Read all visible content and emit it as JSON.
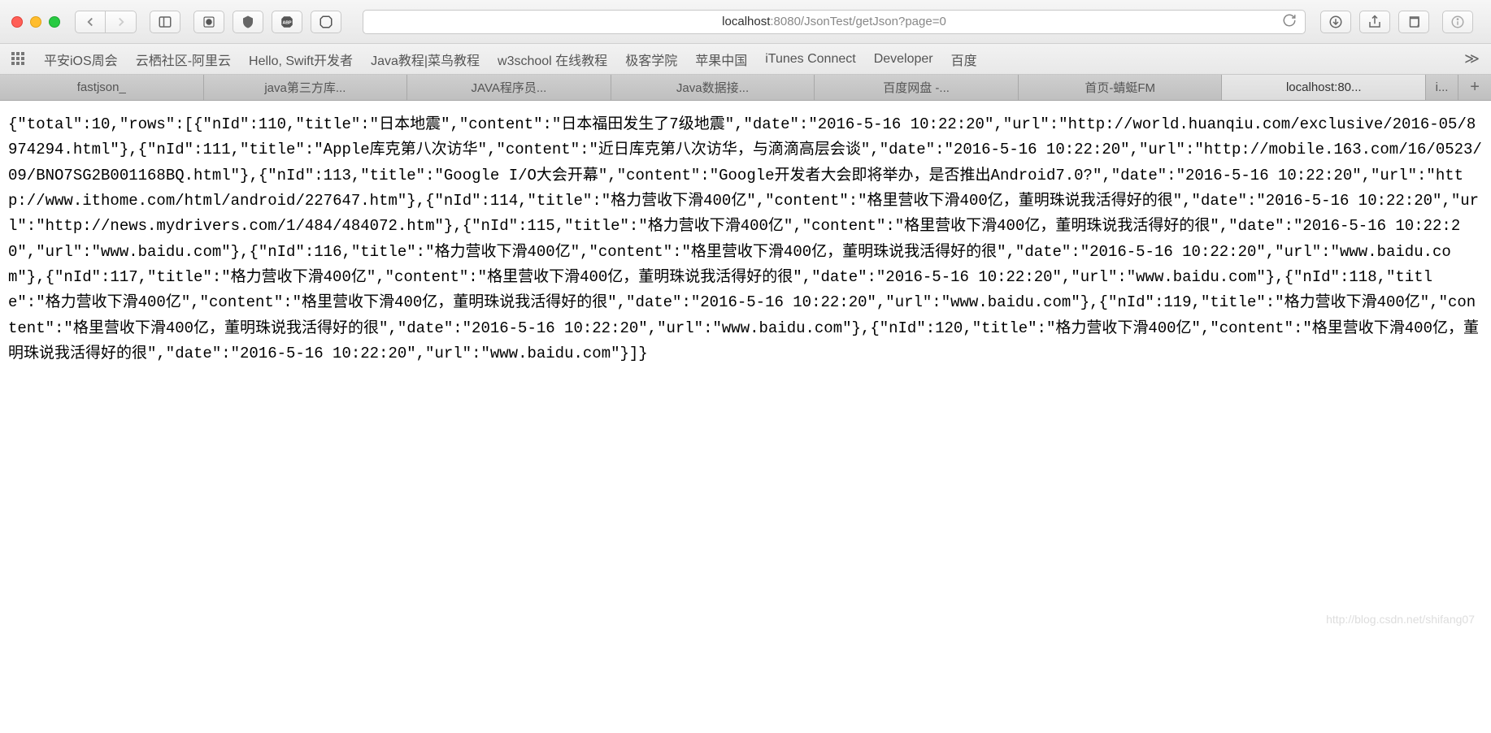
{
  "address": {
    "host": "localhost",
    "port": ":8080",
    "path": "/JsonTest/getJson?page=0"
  },
  "bookmarks": [
    "平安iOS周会",
    "云栖社区-阿里云",
    "Hello, Swift开发者",
    "Java教程|菜鸟教程",
    "w3school 在线教程",
    "极客学院",
    "苹果中国",
    "iTunes Connect",
    "Developer",
    "百度"
  ],
  "tabs": [
    {
      "label": "fastjson_",
      "active": false
    },
    {
      "label": "java第三方库...",
      "active": false
    },
    {
      "label": "JAVA程序员...",
      "active": false
    },
    {
      "label": "Java数据接...",
      "active": false
    },
    {
      "label": "百度网盘 -...",
      "active": false
    },
    {
      "label": "首页-蜻蜓FM",
      "active": false
    },
    {
      "label": "localhost:80...",
      "active": true
    },
    {
      "label": "i...",
      "active": false,
      "small": true
    }
  ],
  "json_body": "{\"total\":10,\"rows\":[{\"nId\":110,\"title\":\"日本地震\",\"content\":\"日本福田发生了7级地震\",\"date\":\"2016-5-16 10:22:20\",\"url\":\"http://world.huanqiu.com/exclusive/2016-05/8974294.html\"},{\"nId\":111,\"title\":\"Apple库克第八次访华\",\"content\":\"近日库克第八次访华，与滴滴高层会谈\",\"date\":\"2016-5-16 10:22:20\",\"url\":\"http://mobile.163.com/16/0523/09/BNO7SG2B001168BQ.html\"},{\"nId\":113,\"title\":\"Google I/O大会开幕\",\"content\":\"Google开发者大会即将举办，是否推出Android7.0?\",\"date\":\"2016-5-16 10:22:20\",\"url\":\"http://www.ithome.com/html/android/227647.htm\"},{\"nId\":114,\"title\":\"格力营收下滑400亿\",\"content\":\"格里营收下滑400亿，董明珠说我活得好的很\",\"date\":\"2016-5-16 10:22:20\",\"url\":\"http://news.mydrivers.com/1/484/484072.htm\"},{\"nId\":115,\"title\":\"格力营收下滑400亿\",\"content\":\"格里营收下滑400亿，董明珠说我活得好的很\",\"date\":\"2016-5-16 10:22:20\",\"url\":\"www.baidu.com\"},{\"nId\":116,\"title\":\"格力营收下滑400亿\",\"content\":\"格里营收下滑400亿，董明珠说我活得好的很\",\"date\":\"2016-5-16 10:22:20\",\"url\":\"www.baidu.com\"},{\"nId\":117,\"title\":\"格力营收下滑400亿\",\"content\":\"格里营收下滑400亿，董明珠说我活得好的很\",\"date\":\"2016-5-16 10:22:20\",\"url\":\"www.baidu.com\"},{\"nId\":118,\"title\":\"格力营收下滑400亿\",\"content\":\"格里营收下滑400亿，董明珠说我活得好的很\",\"date\":\"2016-5-16 10:22:20\",\"url\":\"www.baidu.com\"},{\"nId\":119,\"title\":\"格力营收下滑400亿\",\"content\":\"格里营收下滑400亿，董明珠说我活得好的很\",\"date\":\"2016-5-16 10:22:20\",\"url\":\"www.baidu.com\"},{\"nId\":120,\"title\":\"格力营收下滑400亿\",\"content\":\"格里营收下滑400亿，董明珠说我活得好的很\",\"date\":\"2016-5-16 10:22:20\",\"url\":\"www.baidu.com\"}]}",
  "watermark": "http://blog.csdn.net/shifang07"
}
